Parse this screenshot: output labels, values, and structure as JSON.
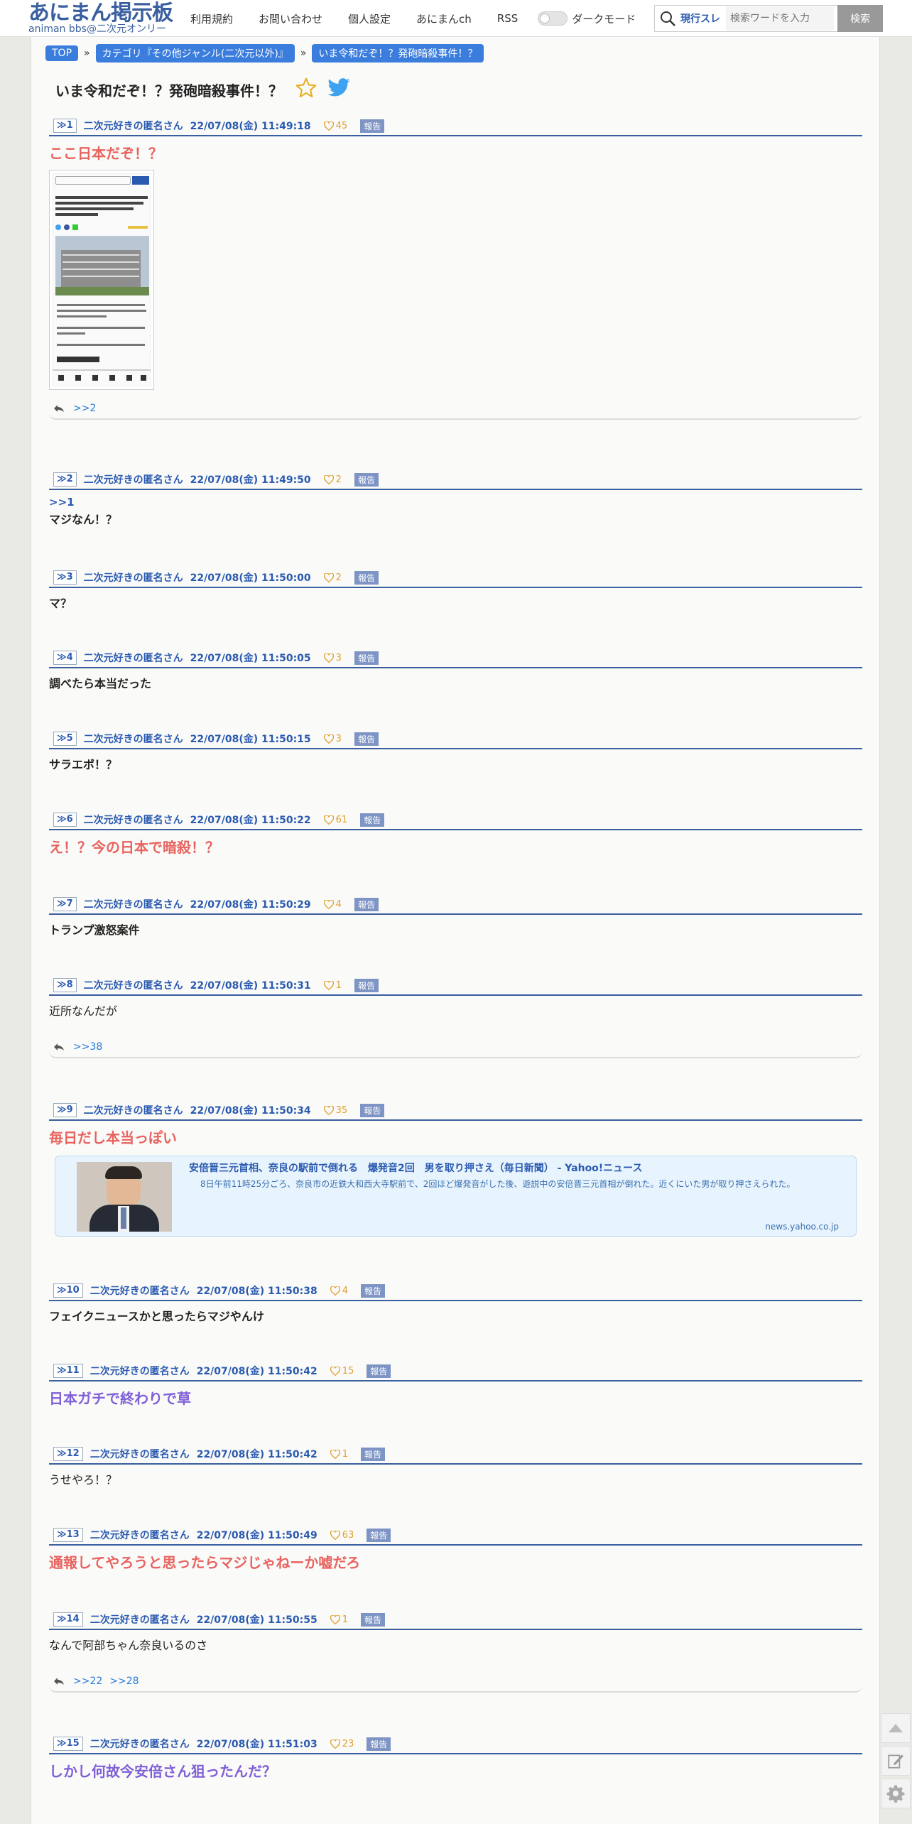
{
  "header": {
    "logo_main": "あにまん掲示板",
    "logo_sub": "animan bbs@二次元オンリー",
    "nav": [
      "利用規約",
      "お問い合わせ",
      "個人設定",
      "あにまんch",
      "RSS"
    ],
    "dark_mode_label": "ダークモード",
    "search_scope": "現行スレ",
    "search_placeholder": "検索ワードを入力",
    "search_button": "検索"
  },
  "breadcrumb": [
    "TOP",
    "カテゴリ『その他ジャンル(二次元以外)』",
    "いま令和だぞ！？発砲暗殺事件！？"
  ],
  "thread_title": "いま令和だぞ！？発砲暗殺事件！？",
  "report_label": "報告",
  "posts": [
    {
      "num": "≫1",
      "name": "二次元好きの匿名さん",
      "date": "22/07/08(金) 11:49:18",
      "likes": "45",
      "anchor": "",
      "text": "ここ日本だぞ！？",
      "replies": ">>2"
    },
    {
      "num": "≫2",
      "name": "二次元好きの匿名さん",
      "date": "22/07/08(金) 11:49:50",
      "likes": "2",
      "anchor": ">>1",
      "text": "マジなん！？",
      "replies": ""
    },
    {
      "num": "≫3",
      "name": "二次元好きの匿名さん",
      "date": "22/07/08(金) 11:50:00",
      "likes": "2",
      "anchor": "",
      "text": "マ？",
      "replies": ""
    },
    {
      "num": "≫4",
      "name": "二次元好きの匿名さん",
      "date": "22/07/08(金) 11:50:05",
      "likes": "3",
      "anchor": "",
      "text": "調べたら本当だった",
      "replies": ""
    },
    {
      "num": "≫5",
      "name": "二次元好きの匿名さん",
      "date": "22/07/08(金) 11:50:15",
      "likes": "3",
      "anchor": "",
      "text": "サラエボ！？",
      "replies": ""
    },
    {
      "num": "≫6",
      "name": "二次元好きの匿名さん",
      "date": "22/07/08(金) 11:50:22",
      "likes": "61",
      "anchor": "",
      "text": "え！？今の日本で暗殺！？",
      "replies": ""
    },
    {
      "num": "≫7",
      "name": "二次元好きの匿名さん",
      "date": "22/07/08(金) 11:50:29",
      "likes": "4",
      "anchor": "",
      "text": "トランプ激怒案件",
      "replies": ""
    },
    {
      "num": "≫8",
      "name": "二次元好きの匿名さん",
      "date": "22/07/08(金) 11:50:31",
      "likes": "1",
      "anchor": "",
      "text": "近所なんだが",
      "replies": ">>38"
    },
    {
      "num": "≫9",
      "name": "二次元好きの匿名さん",
      "date": "22/07/08(金) 11:50:34",
      "likes": "35",
      "anchor": "",
      "text": "毎日だし本当っぽい",
      "replies": ""
    },
    {
      "num": "≫10",
      "name": "二次元好きの匿名さん",
      "date": "22/07/08(金) 11:50:38",
      "likes": "4",
      "anchor": "",
      "text": "フェイクニュースかと思ったらマジやんけ",
      "replies": ""
    },
    {
      "num": "≫11",
      "name": "二次元好きの匿名さん",
      "date": "22/07/08(金) 11:50:42",
      "likes": "15",
      "anchor": "",
      "text": "日本ガチで終わりで草",
      "replies": ""
    },
    {
      "num": "≫12",
      "name": "二次元好きの匿名さん",
      "date": "22/07/08(金) 11:50:42",
      "likes": "1",
      "anchor": "",
      "text": "うせやろ！？",
      "replies": ""
    },
    {
      "num": "≫13",
      "name": "二次元好きの匿名さん",
      "date": "22/07/08(金) 11:50:49",
      "likes": "63",
      "anchor": "",
      "text": "通報してやろうと思ったらマジじゃねーか嘘だろ",
      "replies": ""
    },
    {
      "num": "≫14",
      "name": "二次元好きの匿名さん",
      "date": "22/07/08(金) 11:50:55",
      "likes": "1",
      "anchor": "",
      "text": "なんで阿部ちゃん奈良いるのさ",
      "replies": ">>22"
    },
    {
      "num": "≫15",
      "name": "二次元好きの匿名さん",
      "date": "22/07/08(金) 11:51:03",
      "likes": "23",
      "anchor": "",
      "text": "しかし何故今安倍さん狙ったんだ？",
      "replies": ""
    }
  ],
  "post14_reply2": ">>28",
  "link_card": {
    "title": "安倍晋三元首相、奈良の駅前で倒れる　爆発音2回　男を取り押さえ（毎日新聞） - Yahoo!ニュース",
    "desc": "8日午前11時25分ごろ、奈良市の近鉄大和西大寺駅前で、2回ほど爆発音がした後、遊説中の安倍晋三元首相が倒れた。近くにいた男が取り押さえられた。",
    "domain": "news.yahoo.co.jp"
  },
  "colors": {
    "accent": "#3a5f9f",
    "link": "#2a5ab0",
    "red_text": "#e8635f",
    "purple_text": "#7f5fd8",
    "like": "#e0a030"
  }
}
